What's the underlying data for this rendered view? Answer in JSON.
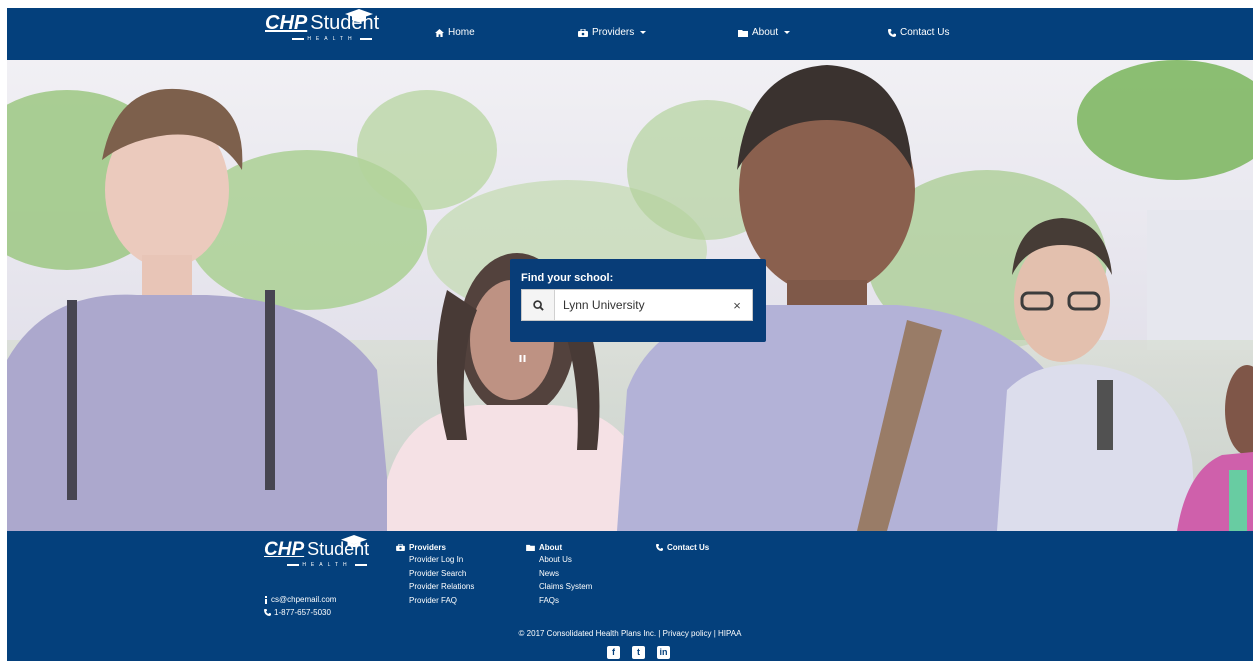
{
  "brand": {
    "logo_chp": "CHP",
    "logo_student": "Student",
    "logo_health": "HEALTH"
  },
  "nav": {
    "home": "Home",
    "providers": "Providers",
    "about": "About",
    "contact": "Contact Us"
  },
  "finder": {
    "title": "Find your school:",
    "query": "Lynn University",
    "clear_label": "×"
  },
  "footer": {
    "email": "cs@chpemail.com",
    "phone": "1-877-657-5030",
    "providers": {
      "heading": "Providers",
      "links": [
        "Provider Log In",
        "Provider Search",
        "Provider Relations",
        "Provider FAQ"
      ]
    },
    "about": {
      "heading": "About",
      "links": [
        "About Us",
        "News",
        "Claims System",
        "FAQs"
      ]
    },
    "contact": {
      "heading": "Contact Us"
    },
    "copyright": "© 2017 Consolidated Health Plans Inc. | Privacy policy | HIPAA",
    "social": {
      "facebook": "f",
      "twitter": "t",
      "linkedin": "in"
    }
  },
  "colors": {
    "brand_navy": "#04407c",
    "finder_navy": "#083d78",
    "white": "#ffffff"
  }
}
